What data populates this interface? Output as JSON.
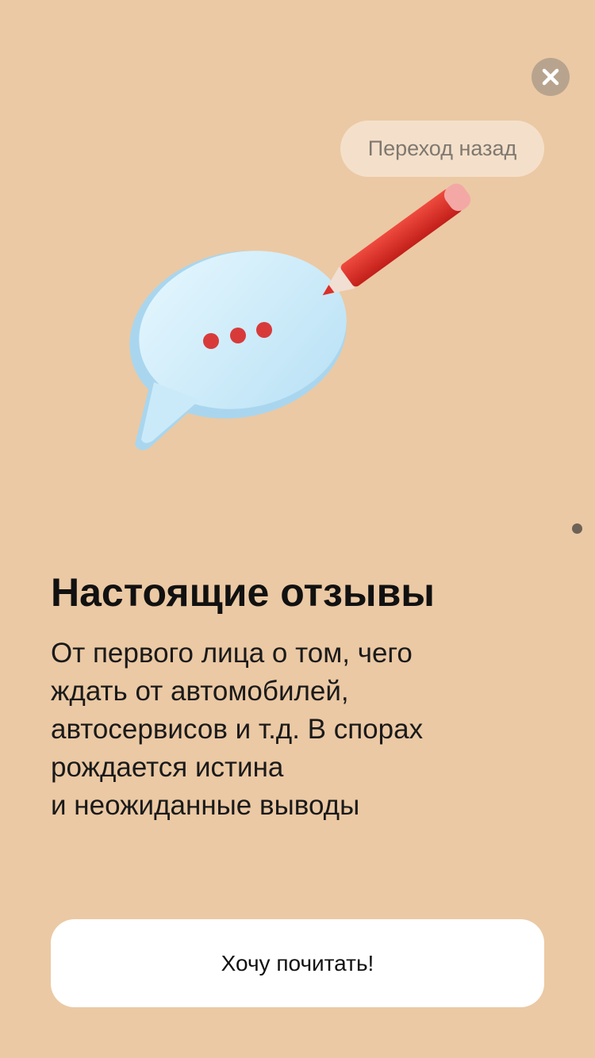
{
  "header": {
    "close_icon": "close-icon",
    "back_hint_label": "Переход назад"
  },
  "illustration": {
    "icon": "speech-bubble-pencil-icon",
    "colors": {
      "bubble": "#c9eaf9",
      "pencil": "#d9312a",
      "dots": "#d83a3a"
    }
  },
  "pager": {
    "active_page": 1
  },
  "content": {
    "title": "Настоящие отзывы",
    "description_lines": [
      "От первого лица о том, чего",
      "ждать от автомобилей,",
      "автосервисов и т.д. В спорах",
      "рождается истина",
      "и неожиданные выводы"
    ]
  },
  "footer": {
    "cta_label": "Хочу почитать!"
  },
  "colors": {
    "background": "#ebc9a4",
    "close_button": "#b8a48e",
    "hint_bubble": "#f4e0ca",
    "cta_background": "#ffffff"
  }
}
